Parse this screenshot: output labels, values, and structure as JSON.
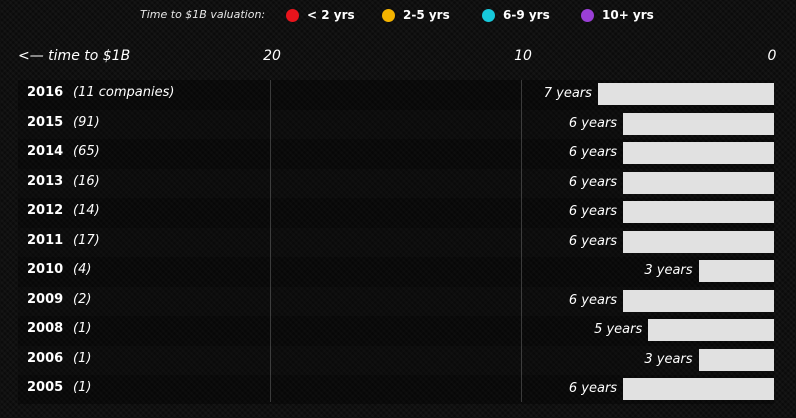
{
  "legend": {
    "title": "Time to $1B valuation:",
    "items": [
      {
        "label": "< 2 yrs",
        "color": "#e8141c"
      },
      {
        "label": "2-5 yrs",
        "color": "#f5b400"
      },
      {
        "label": "6-9 yrs",
        "color": "#17c9db"
      },
      {
        "label": "10+ yrs",
        "color": "#9a3fd6"
      }
    ]
  },
  "chart_data": {
    "type": "bar",
    "orientation": "horizontal",
    "xlabel": "<— time to $1B",
    "xlim": [
      0,
      20
    ],
    "xaxis_reversed": true,
    "xticks": [
      "20",
      "10",
      "0"
    ],
    "bar_color": "#e1e1e1",
    "grid": true,
    "categories": [
      "2016",
      "2015",
      "2014",
      "2013",
      "2012",
      "2011",
      "2010",
      "2009",
      "2008",
      "2006",
      "2005"
    ],
    "counts": [
      "(11 companies)",
      "(91)",
      "(65)",
      "(16)",
      "(14)",
      "(17)",
      "(4)",
      "(2)",
      "(1)",
      "(1)",
      "(1)"
    ],
    "values": [
      7,
      6,
      6,
      6,
      6,
      6,
      3,
      6,
      5,
      3,
      6
    ],
    "value_labels": [
      "7 years",
      "6 years",
      "6 years",
      "6 years",
      "6 years",
      "6 years",
      "3 years",
      "6 years",
      "5 years",
      "3 years",
      "6 years"
    ]
  }
}
